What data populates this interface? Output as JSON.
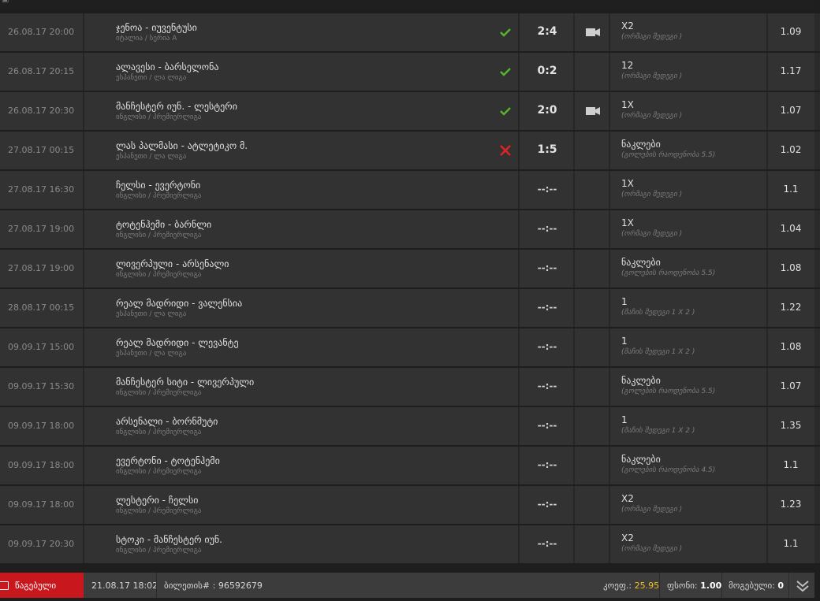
{
  "rows": [
    {
      "time": "26.08.17 20:00",
      "match": "ჯენოა - იუვენტუსი",
      "league": "იტალია / სერია A",
      "status": "win",
      "score": "2:4",
      "video": true,
      "bet": "X2",
      "bettype": "(ორმაგი შედეგი )",
      "odd": "1.09"
    },
    {
      "time": "26.08.17 20:15",
      "match": "ალავესი - ბარსელონა",
      "league": "ესპანეთი / ლა ლიგა",
      "status": "win",
      "score": "0:2",
      "video": false,
      "bet": "12",
      "bettype": "(ორმაგი შედეგი )",
      "odd": "1.17"
    },
    {
      "time": "26.08.17 20:30",
      "match": "მანჩესტერ იუნ. - ლესტერი",
      "league": "ინგლისი / პრემიერლიგა",
      "status": "win",
      "score": "2:0",
      "video": true,
      "bet": "1X",
      "bettype": "(ორმაგი შედეგი )",
      "odd": "1.07"
    },
    {
      "time": "27.08.17 00:15",
      "match": "ლას პალმასი - ატლეტიკო მ.",
      "league": "ესპანეთი / ლა ლიგა",
      "status": "lose",
      "score": "1:5",
      "video": false,
      "bet": "ნაკლები",
      "bettype": "(გოლების რაოდენობა 5.5)",
      "odd": "1.02"
    },
    {
      "time": "27.08.17 16:30",
      "match": "ჩელსი - ევერტონი",
      "league": "ინგლისი / პრემიერლიგა",
      "status": "none",
      "score": "--:--",
      "video": false,
      "bet": "1X",
      "bettype": "(ორმაგი შედეგი )",
      "odd": "1.1"
    },
    {
      "time": "27.08.17 19:00",
      "match": "ტოტენჰემი - ბარნლი",
      "league": "ინგლისი / პრემიერლიგა",
      "status": "none",
      "score": "--:--",
      "video": false,
      "bet": "1X",
      "bettype": "(ორმაგი შედეგი )",
      "odd": "1.04"
    },
    {
      "time": "27.08.17 19:00",
      "match": "ლივერპული - არსენალი",
      "league": "ინგლისი / პრემიერლიგა",
      "status": "none",
      "score": "--:--",
      "video": false,
      "bet": "ნაკლები",
      "bettype": "(გოლების რაოდენობა 5.5)",
      "odd": "1.08"
    },
    {
      "time": "28.08.17 00:15",
      "match": "რეალ მადრიდი - ვალენსია",
      "league": "ესპანეთი / ლა ლიგა",
      "status": "none",
      "score": "--:--",
      "video": false,
      "bet": "1",
      "bettype": "(მაჩის შედეგი 1 X 2 )",
      "odd": "1.22"
    },
    {
      "time": "09.09.17 15:00",
      "match": "რეალ მადრიდი - ლევანტე",
      "league": "ესპანეთი / ლა ლიგა",
      "status": "none",
      "score": "--:--",
      "video": false,
      "bet": "1",
      "bettype": "(მაჩის შედეგი 1 X 2 )",
      "odd": "1.08"
    },
    {
      "time": "09.09.17 15:30",
      "match": "მანჩესტერ სიტი - ლივერპული",
      "league": "ინგლისი / პრემიერლიგა",
      "status": "none",
      "score": "--:--",
      "video": false,
      "bet": "ნაკლები",
      "bettype": "(გოლების რაოდენობა 5.5)",
      "odd": "1.07"
    },
    {
      "time": "09.09.17 18:00",
      "match": "არსენალი - ბორნმუტი",
      "league": "ინგლისი / პრემიერლიგა",
      "status": "none",
      "score": "--:--",
      "video": false,
      "bet": "1",
      "bettype": "(მაჩის შედეგი 1 X 2 )",
      "odd": "1.35"
    },
    {
      "time": "09.09.17 18:00",
      "match": "ევერტონი - ტოტენჰემი",
      "league": "ინგლისი / პრემიერლიგა",
      "status": "none",
      "score": "--:--",
      "video": false,
      "bet": "ნაკლები",
      "bettype": "(გოლების რაოდენობა 4.5)",
      "odd": "1.1"
    },
    {
      "time": "09.09.17 18:00",
      "match": "ლესტერი - ჩელსი",
      "league": "ინგლისი / პრემიერლიგა",
      "status": "none",
      "score": "--:--",
      "video": false,
      "bet": "X2",
      "bettype": "(ორმაგი შედეგი )",
      "odd": "1.23"
    },
    {
      "time": "09.09.17 20:30",
      "match": "სტოკი - მანჩესტერ იუნ.",
      "league": "ინგლისი / პრემიერლიგა",
      "status": "none",
      "score": "--:--",
      "video": false,
      "bet": "X2",
      "bettype": "(ორმაგი შედეგი )",
      "odd": "1.1"
    }
  ],
  "footer": {
    "status_label": "წაგებული",
    "date": "21.08.17 18:02",
    "ticket_label": "ბილეთის# :",
    "ticket_number": "96592679",
    "coef_label": "კოეფ.:",
    "coef_value": "25.95",
    "stake_label": "ფსონი:",
    "stake_value": "1.00",
    "won_label": "მოგებული:",
    "won_value": "0"
  },
  "colors": {
    "win": "#55b52c",
    "lose": "#e02424",
    "accent": "#c8171d",
    "highlight": "#f0c020"
  },
  "icons": {
    "win": "check-icon",
    "lose": "cross-icon",
    "video": "video-camera-icon",
    "expand": "double-chevron-down-icon"
  }
}
